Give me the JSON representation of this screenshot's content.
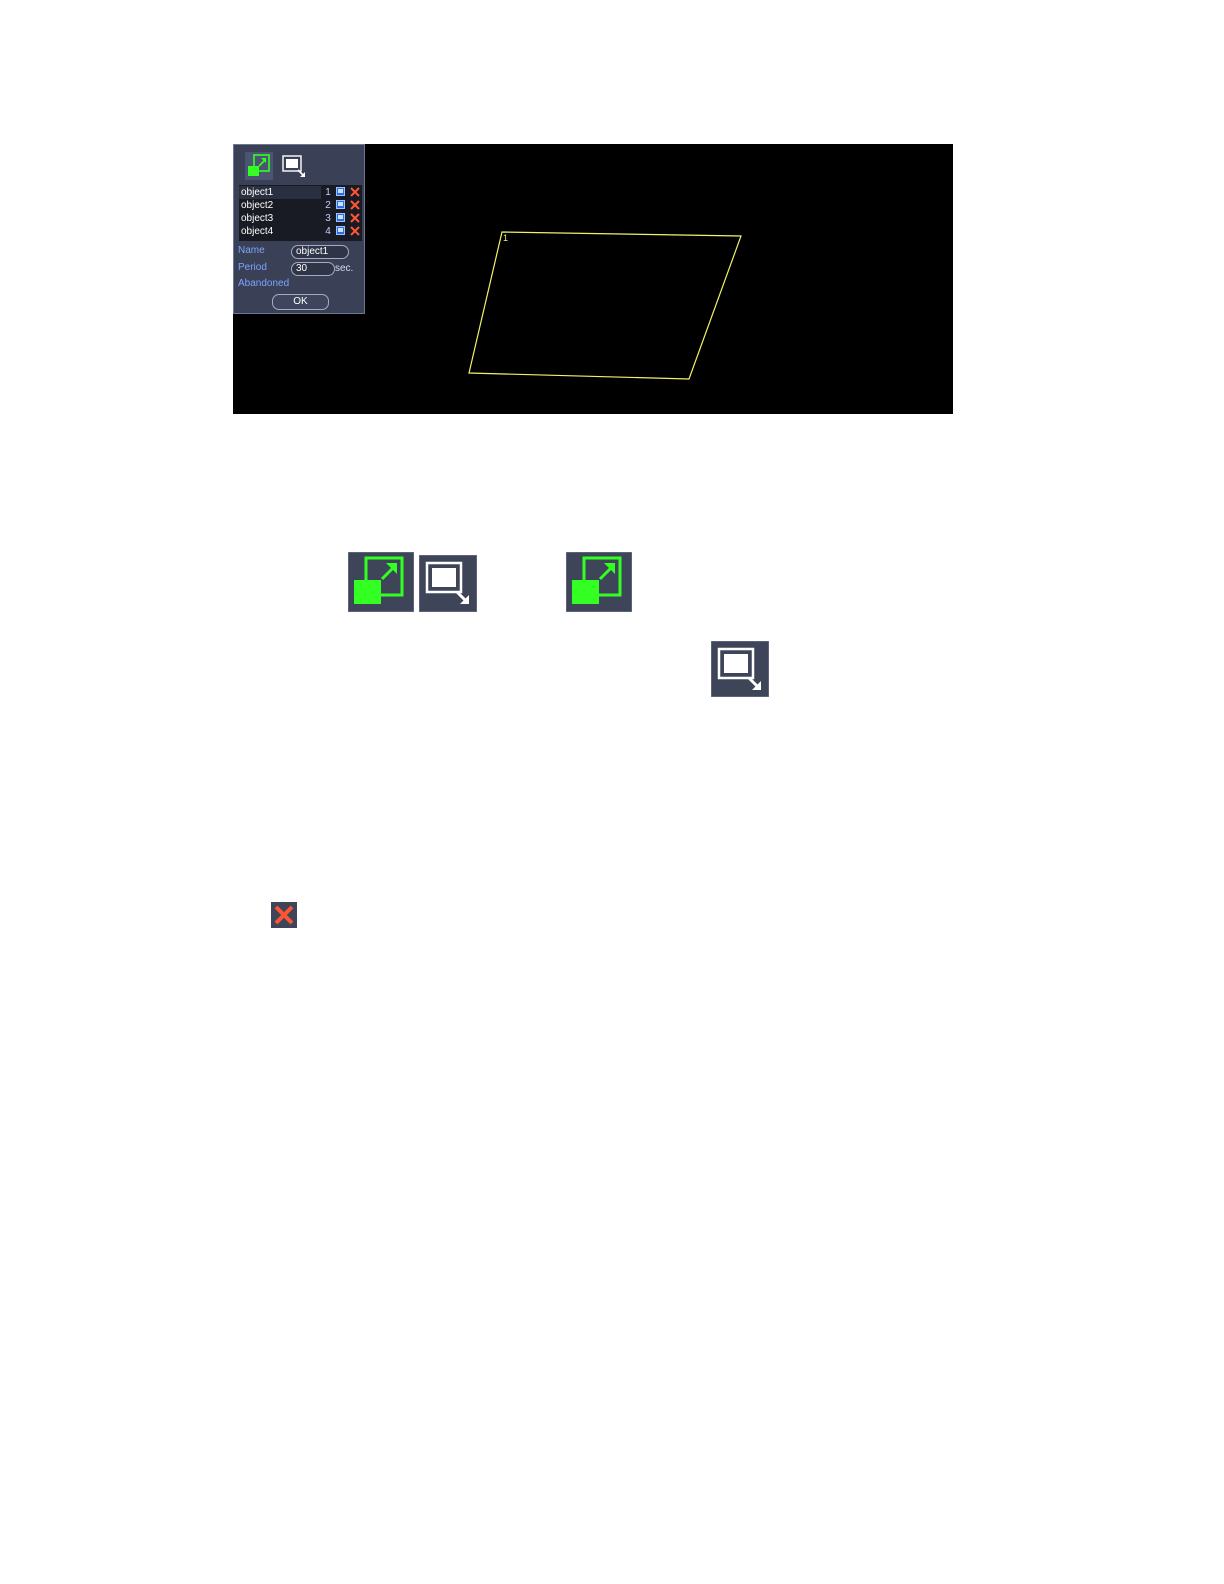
{
  "panel": {
    "objects": [
      {
        "name": "object1",
        "num": "1",
        "selected": true
      },
      {
        "name": "object2",
        "num": "2",
        "selected": false
      },
      {
        "name": "object3",
        "num": "3",
        "selected": false
      },
      {
        "name": "object4",
        "num": "4",
        "selected": false
      }
    ],
    "name_label": "Name",
    "name_value": "object1",
    "period_label": "Period",
    "period_value": "30",
    "period_unit": "sec.",
    "abandoned_label": "Abandoned",
    "ok_label": "OK"
  },
  "region": {
    "label": "1",
    "color": "#f2f26a"
  },
  "icons": {
    "draw_region": "draw-region-icon",
    "select_region": "select-region-icon",
    "edit": "edit-icon",
    "delete": "delete-icon"
  },
  "colors": {
    "panel_bg": "#3a4157",
    "accent_green": "#33ff22",
    "label_blue": "#7ea2ff",
    "delete_red": "#ff5533"
  }
}
